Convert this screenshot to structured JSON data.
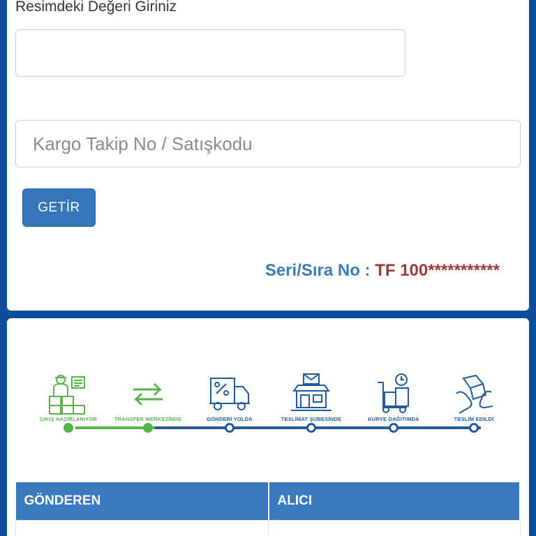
{
  "form": {
    "captcha_label": "Resimdeki Değeri Giriniz",
    "captcha_value": "",
    "tracking_placeholder": "Kargo Takip No / Satışkodu",
    "submit_label": "GETİR",
    "serial_label": "Seri/Sıra No : ",
    "serial_value": "TF 100***********"
  },
  "tracker": {
    "steps": [
      {
        "label": "ÇIKIŞ HAZIRLANIYOR",
        "icon": "worker-boxes-icon",
        "status": "done"
      },
      {
        "label": "TRANSFER MERKEZİNDE",
        "icon": "transfer-arrows-icon",
        "status": "done"
      },
      {
        "label": "GÖNDERİ YOLDA",
        "icon": "truck-icon",
        "status": "pending"
      },
      {
        "label": "TESLİMAT ŞUBESİNDE",
        "icon": "branch-store-icon",
        "status": "pending"
      },
      {
        "label": "KURYE DAĞITIMDA",
        "icon": "hand-truck-icon",
        "status": "pending"
      },
      {
        "label": "TESLİM EDİLDİ",
        "icon": "delivered-hands-icon",
        "status": "pending"
      }
    ],
    "colors": {
      "done": "#57b34a",
      "pending": "#1f5b9c"
    }
  },
  "table": {
    "headers": [
      "GÖNDEREN",
      "ALICI"
    ]
  },
  "colors": {
    "background": "#0e4f9c",
    "button": "#3576b9",
    "table_header": "#3a78bf",
    "serial_label": "#3a7ab8",
    "serial_value": "#9b3a3a"
  }
}
